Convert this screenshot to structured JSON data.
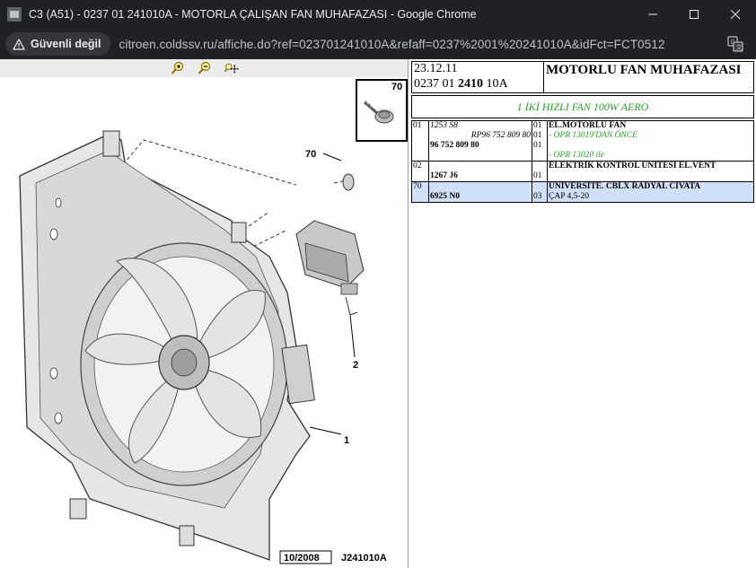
{
  "window": {
    "title": "C3 (A51) - 0237 01 241010A - MOTORLA ÇALIŞAN FAN MUHAFAZASI - Google Chrome",
    "minimize_icon": "minimize-icon",
    "maximize_icon": "maximize-icon",
    "close_icon": "close-icon"
  },
  "addressbar": {
    "security_label": "Güvenli değil",
    "url": "citroen.coldssv.ru/affiche.do?ref=023701241010A&refaff=0237%2001%20241010A&idFct=FCT0512"
  },
  "zoom_bar": {
    "icons": [
      "zoom-in-icon",
      "zoom-out-icon",
      "zoom-pan-icon"
    ]
  },
  "drawing": {
    "labels": [
      "70",
      "70",
      "2",
      "1"
    ],
    "inset_label": "70",
    "date_code": "10/2008",
    "drawing_code": "J241010A"
  },
  "header": {
    "date": "23.12.11",
    "ref_prefix": "0237 01 ",
    "ref_bold": "2410",
    "ref_suffix": " 10A",
    "title": "MOTORLU FAN MUHAFAZASI"
  },
  "subtitle": "1 İKİ HIZLI FAN 100W AERO",
  "parts": [
    {
      "no": "01",
      "ref_top": "1253 S8",
      "ref_rp": "RP96",
      "ref_rp_num": " 752 809 80",
      "ref_main": "96 752 809 80",
      "qty_lines": [
        "01",
        "01",
        "01"
      ],
      "desc": "EL.MOTORLU FAN",
      "notes": [
        "- OPR 13019'DAN ÖNCE",
        "- OPR 13020 ile"
      ]
    },
    {
      "no": "02",
      "ref_main": "1267 J6",
      "qty": "01",
      "desc": "ELEKTRİK KONTROL ÜNİTESİ EL.VENT"
    },
    {
      "no": "70",
      "ref_main": "6925 N0",
      "qty": "03",
      "desc": "ÜNİVERSİTE. CBLX RADYAL CIVATA",
      "desc2": "ÇAP 4,5-20",
      "highlighted": true
    }
  ]
}
